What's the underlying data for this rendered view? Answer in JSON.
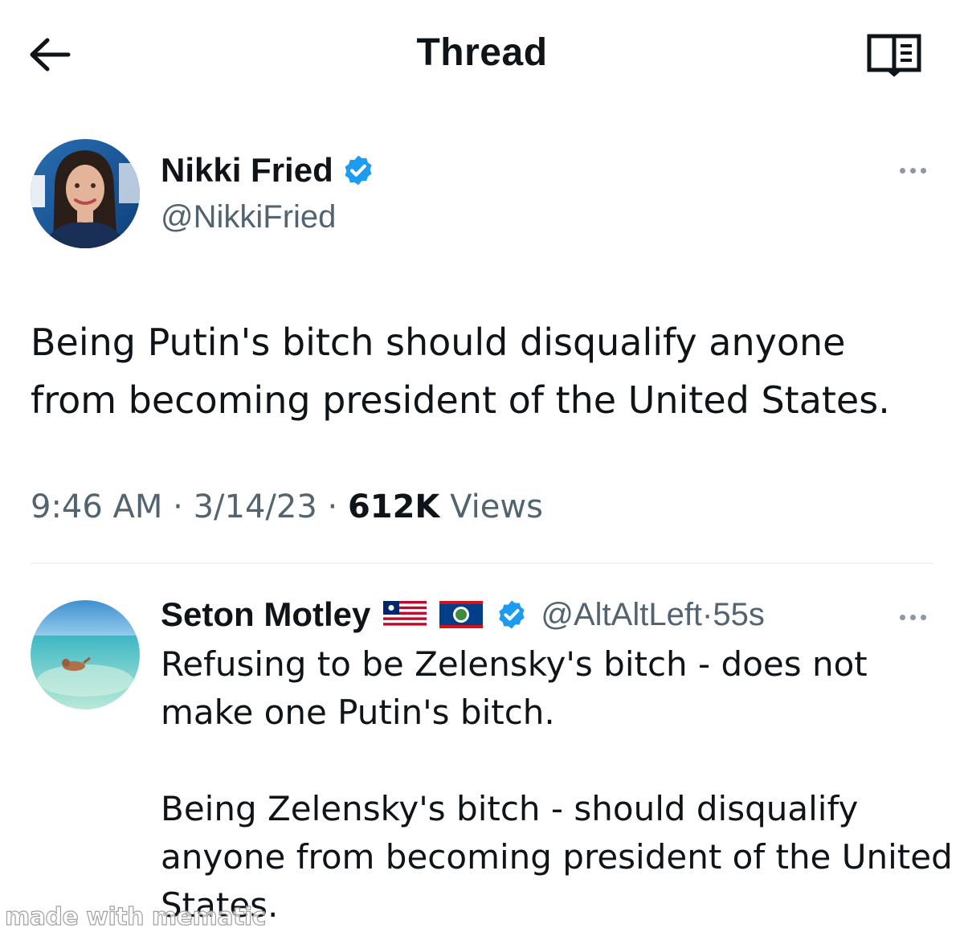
{
  "header": {
    "title": "Thread",
    "back_icon": "arrow-left-icon",
    "reader_icon": "reader-mode-icon"
  },
  "main_tweet": {
    "display_name": "Nikki Fried",
    "handle": "@NikkiFried",
    "verified": true,
    "text_lines": [
      "Being Putin's bitch should disqualify anyone",
      "from becoming president of the United States."
    ],
    "time": "9:46 AM",
    "date": "3/14/23",
    "separator": "·",
    "views_count": "612K",
    "views_label": "Views"
  },
  "reply": {
    "display_name": "Seton Motley",
    "flags": [
      "flag-liberia-icon",
      "flag-belize-icon"
    ],
    "verified": true,
    "handle": "@AltAltLeft",
    "separator": "·",
    "age": "55s",
    "paragraphs": [
      "Refusing to be Zelensky's bitch - does not make one Putin's bitch.",
      "Being Zelensky's bitch - should disqualify anyone from becoming president of the United States."
    ]
  },
  "watermark": "made with mematic",
  "colors": {
    "verified_blue": "#1d9bf0",
    "secondary_text": "#536471",
    "primary_text": "#0f1419",
    "divider": "#eff3f4"
  }
}
